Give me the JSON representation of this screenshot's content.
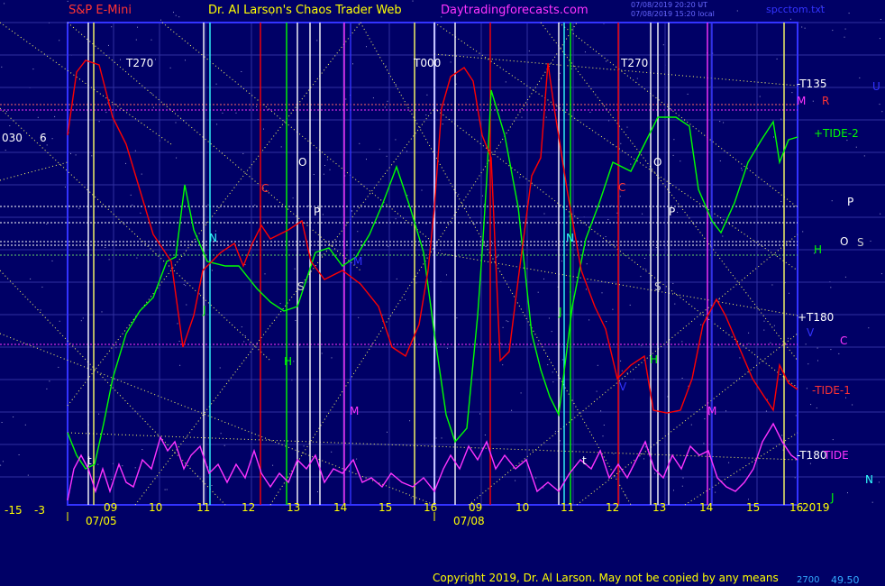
{
  "header": {
    "instrument": "S&P E-Mini",
    "site": "Dr. Al Larson's Chaos Trader Web",
    "url": "Daytradingforecasts.com",
    "timestamp_1": "07/08/2019 20:20 UT",
    "timestamp_2": "07/08/2019 15:20 local",
    "file": "spcctom.txt"
  },
  "footer": {
    "copyright": "Copyright 2019, Dr. Al Larson. May not be copied by any means",
    "readout": "2700",
    "value": "49.50"
  },
  "colors": {
    "background": "#000066",
    "grid": "#3030a0",
    "red": "#ff0000",
    "green": "#00ff00",
    "magenta": "#ff33ff",
    "yellow": "#ffff66",
    "white": "#ffffff",
    "cyan": "#33ffff",
    "blue": "#3333ff"
  },
  "chart_data": {
    "type": "line",
    "x_axis": {
      "panel_1_ticks": [
        "09",
        "10",
        "11",
        "12",
        "13",
        "14",
        "15",
        "16"
      ],
      "panel_2_ticks": [
        "09",
        "10",
        "11",
        "12",
        "13",
        "14",
        "15",
        "16"
      ],
      "dates": [
        "07/05",
        "07/08"
      ],
      "year": "2019",
      "left_labels": [
        "-15",
        "-3"
      ]
    },
    "cycle_labels": [
      {
        "text": "T270",
        "color": "#ffffff"
      },
      {
        "text": "T000",
        "color": "#ffffff"
      },
      {
        "text": "T270",
        "color": "#ffffff"
      }
    ],
    "left_labels": [
      {
        "text": "030",
        "color": "#ffffff"
      },
      {
        "text": "6",
        "color": "#ffffff"
      }
    ],
    "right_labels": [
      {
        "text": "-T135",
        "color": "#ffffff"
      },
      {
        "text": "U",
        "color": "#3333ff"
      },
      {
        "text": "M",
        "color": "#ff33ff"
      },
      {
        "text": "R",
        "color": "#ff3333"
      },
      {
        "text": "+TIDE-2",
        "color": "#00ff00"
      },
      {
        "text": "P",
        "color": "#ffffff"
      },
      {
        "text": "O",
        "color": "#ffffff"
      },
      {
        "text": "S",
        "color": "#cccccc"
      },
      {
        "text": "H",
        "color": "#00ff00"
      },
      {
        "text": "+T180",
        "color": "#ffffff"
      },
      {
        "text": "V",
        "color": "#3333ff"
      },
      {
        "text": "C",
        "color": "#ff33ff"
      },
      {
        "text": "-TIDE-1",
        "color": "#ff3333"
      },
      {
        "text": "-T180",
        "color": "#ffffff"
      },
      {
        "text": "TIDE",
        "color": "#ff33ff"
      },
      {
        "text": "N",
        "color": "#33ffff"
      },
      {
        "text": "J",
        "color": "#00ff00"
      }
    ],
    "marker_labels": [
      {
        "text": "O",
        "color": "#ffffff"
      },
      {
        "text": "P",
        "color": "#ffffff"
      },
      {
        "text": "C",
        "color": "#ff3333"
      },
      {
        "text": "N",
        "color": "#33ffff"
      },
      {
        "text": "M",
        "color": "#3333ff"
      },
      {
        "text": "S",
        "color": "#cccccc"
      },
      {
        "text": "J",
        "color": "#00ff00"
      },
      {
        "text": "H",
        "color": "#00ff00"
      },
      {
        "text": "M",
        "color": "#ff33ff"
      },
      {
        "text": "t",
        "color": "#ffffff"
      },
      {
        "text": "O",
        "color": "#ffffff"
      },
      {
        "text": "P",
        "color": "#ffffff"
      },
      {
        "text": "C",
        "color": "#ff3333"
      },
      {
        "text": "N",
        "color": "#33ffff"
      },
      {
        "text": "S",
        "color": "#cccccc"
      },
      {
        "text": "J",
        "color": "#00ff00"
      },
      {
        "text": "H",
        "color": "#00ff00"
      },
      {
        "text": "V",
        "color": "#3333ff"
      },
      {
        "text": "M",
        "color": "#ff33ff"
      },
      {
        "text": "t",
        "color": "#ffffff"
      }
    ],
    "series": [
      {
        "name": "+TIDE-2",
        "color": "#00ff00"
      },
      {
        "name": "-TIDE-1",
        "color": "#ff0000"
      },
      {
        "name": "TIDE",
        "color": "#ff33ff"
      }
    ]
  }
}
